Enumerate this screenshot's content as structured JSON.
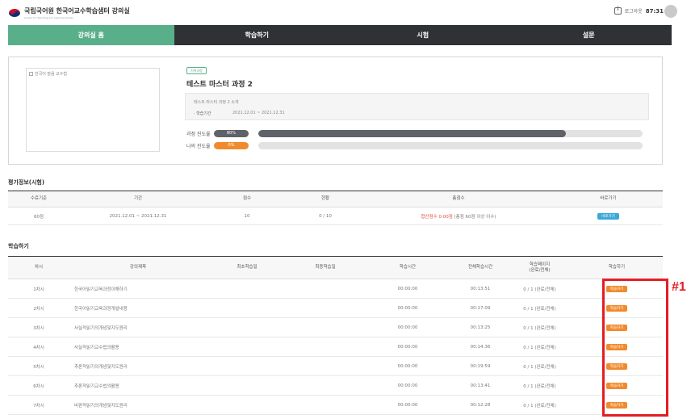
{
  "header": {
    "logo_main": "국립국어원 한국어교수학습샘터 강의실",
    "logo_sub": "Center for Teaching and Learning Korean",
    "logout_label": "로그아웃",
    "timer": "87:31",
    "logo_colors": [
      "#c8102e",
      "#003478"
    ]
  },
  "nav": {
    "tabs": [
      {
        "label": "강의실 홈",
        "active": true
      },
      {
        "label": "학습하기",
        "active": false
      },
      {
        "label": "시험",
        "active": false
      },
      {
        "label": "설문",
        "active": false
      }
    ],
    "colors": {
      "active": "#5aaf8b",
      "bar": "#2f3135"
    }
  },
  "course": {
    "thumbnail_alt": "한국어 발음 교수법",
    "badge": "기획과정",
    "title": "테스트 마스터 과정 2",
    "intro": "테스트 마스터 과정 2 소개",
    "period_label": "· 학습기간",
    "period": "2021.12.01 ~ 2021.12.31",
    "course_progress_label": "과정 진도율",
    "course_progress_text": "80%",
    "course_progress_value": 0.8,
    "my_progress_label": "나의 진도율",
    "my_progress_text": "0%",
    "my_progress_value": 0.0,
    "colors": {
      "course": "#5f6369",
      "mine": "#f08a2c",
      "accent": "#5aaf8b"
    }
  },
  "eval": {
    "section_title": "평가정보(시험)",
    "headers": [
      "수료기준",
      "기간",
      "점수",
      "현황",
      "총점수",
      "바로가기"
    ],
    "row": {
      "criteria": "60점",
      "period": "2021.12.01 ~ 2021.12.31",
      "score": "10",
      "status": "0 / 10",
      "total_red": "합산점수 0.00점",
      "total_rest": "(총점 60점 이상 이수)",
      "button": "바로가기"
    }
  },
  "study": {
    "section_title": "학습하기",
    "headers": [
      "차시",
      "강의제목",
      "최초학습일",
      "최종학습일",
      "학습시간",
      "전체학습시간",
      "학습페이지\n(완료/전체)",
      "학습하기"
    ],
    "rows": [
      {
        "no": "1차시",
        "title": "한국어읽기교육과정이해하기",
        "first": "",
        "last": "",
        "time": "00:00:00",
        "total": "00:13:51",
        "pages": "0 / 1 (완료/전체)",
        "button": "학습하기"
      },
      {
        "no": "2차시",
        "title": "한국어읽기교육과정개발내용",
        "first": "",
        "last": "",
        "time": "00:00:00",
        "total": "00:17:09",
        "pages": "0 / 1 (완료/전체)",
        "button": "학습하기"
      },
      {
        "no": "3차시",
        "title": "사실적읽기의개념및지도원리",
        "first": "",
        "last": "",
        "time": "00:00:00",
        "total": "00:13:25",
        "pages": "0 / 1 (완료/전체)",
        "button": "학습하기"
      },
      {
        "no": "4차시",
        "title": "사실적읽기교수법의활용",
        "first": "",
        "last": "",
        "time": "00:00:00",
        "total": "00:14:36",
        "pages": "0 / 1 (완료/전체)",
        "button": "학습하기"
      },
      {
        "no": "5차시",
        "title": "추론적읽기의개념및지도원리",
        "first": "",
        "last": "",
        "time": "00:00:00",
        "total": "00:19:59",
        "pages": "0 / 1 (완료/전체)",
        "button": "학습하기"
      },
      {
        "no": "6차시",
        "title": "추론적읽기교수법의활용",
        "first": "",
        "last": "",
        "time": "00:00:00",
        "total": "00:13:41",
        "pages": "0 / 1 (완료/전체)",
        "button": "학습하기"
      },
      {
        "no": "7차시",
        "title": "비판적읽기의개념및지도원리",
        "first": "",
        "last": "",
        "time": "00:00:00",
        "total": "00:12:28",
        "pages": "0 / 1 (완료/전체)",
        "button": "학습하기"
      }
    ]
  },
  "annotation": {
    "label": "#1",
    "color": "#e51c23"
  }
}
